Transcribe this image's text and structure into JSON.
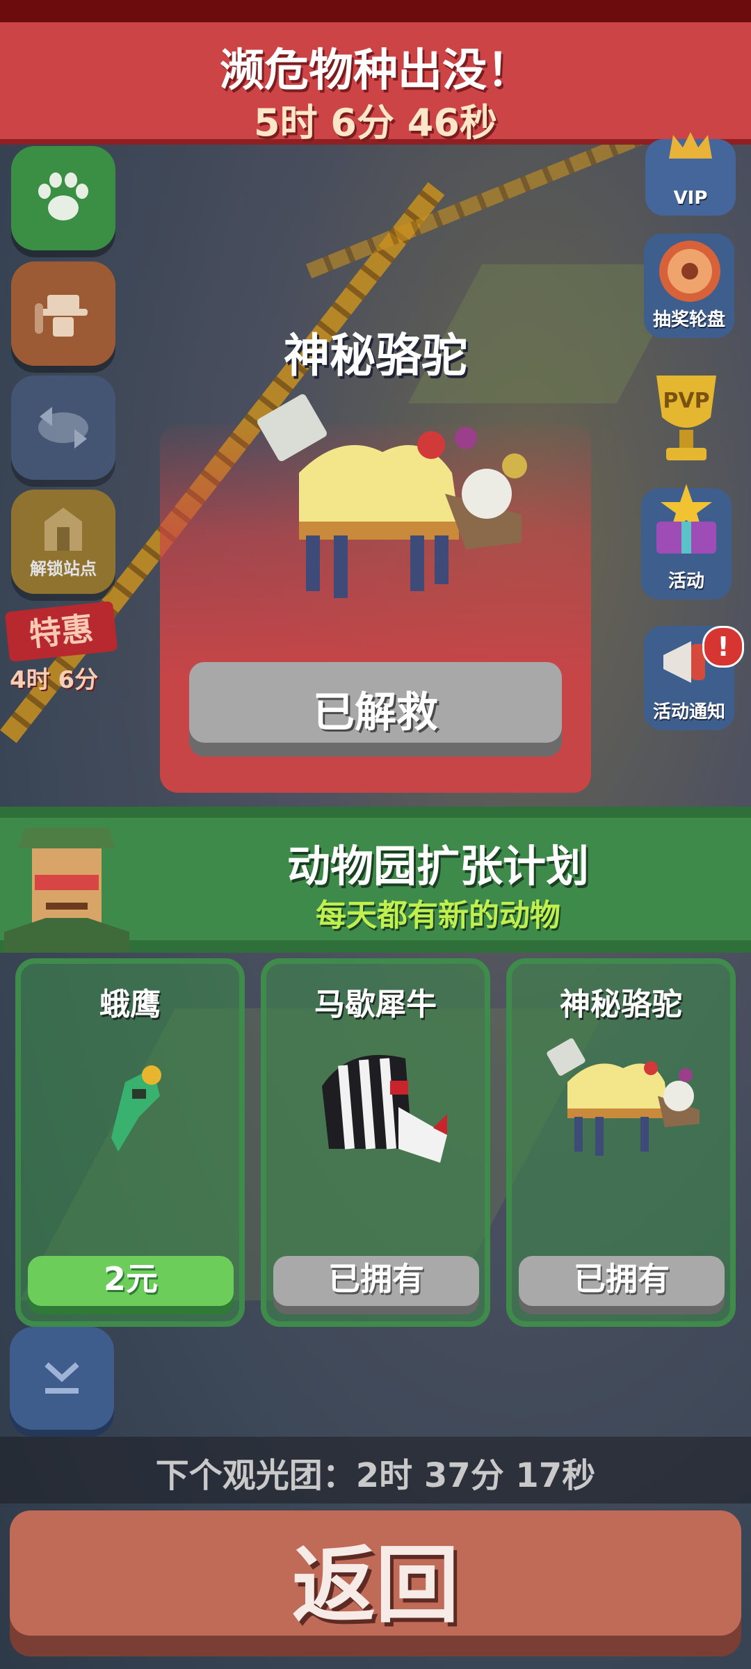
{
  "banner": {
    "title": "濒危物种出没！",
    "timer": "5时 6分 46秒"
  },
  "left_menu": {
    "paw_icon": "paw-icon",
    "ranger_icon": "ranger-icon",
    "swap_icon": "swap-icon",
    "unlock_label": "解锁站点",
    "promo_title": "特惠",
    "promo_time": "4时 6分"
  },
  "right_menu": {
    "vip_label": "VIP",
    "lottery_label": "抽奖轮盘",
    "pvp_label": "PVP",
    "event_label": "活动",
    "notice_label": "活动通知",
    "notice_badge": "!"
  },
  "popup": {
    "animal_name": "神秘骆驼",
    "status_button": "已解救"
  },
  "expansion": {
    "title": "动物园扩张计划",
    "subtitle": "每天都有新的动物"
  },
  "cards": [
    {
      "name": "蛾鹰",
      "button": "2元",
      "state": "buy"
    },
    {
      "name": "马歇犀牛",
      "button": "已拥有",
      "state": "owned"
    },
    {
      "name": "神秘骆驼",
      "button": "已拥有",
      "state": "owned"
    }
  ],
  "bottom": {
    "tour_text": "下个观光团：2时 37分 17秒",
    "back_label": "返回"
  },
  "colors": {
    "banner_red": "#cd4446",
    "plan_green": "#3e8a4a",
    "buy_green": "#6ccd5a",
    "owned_grey": "#a9a9a9"
  }
}
